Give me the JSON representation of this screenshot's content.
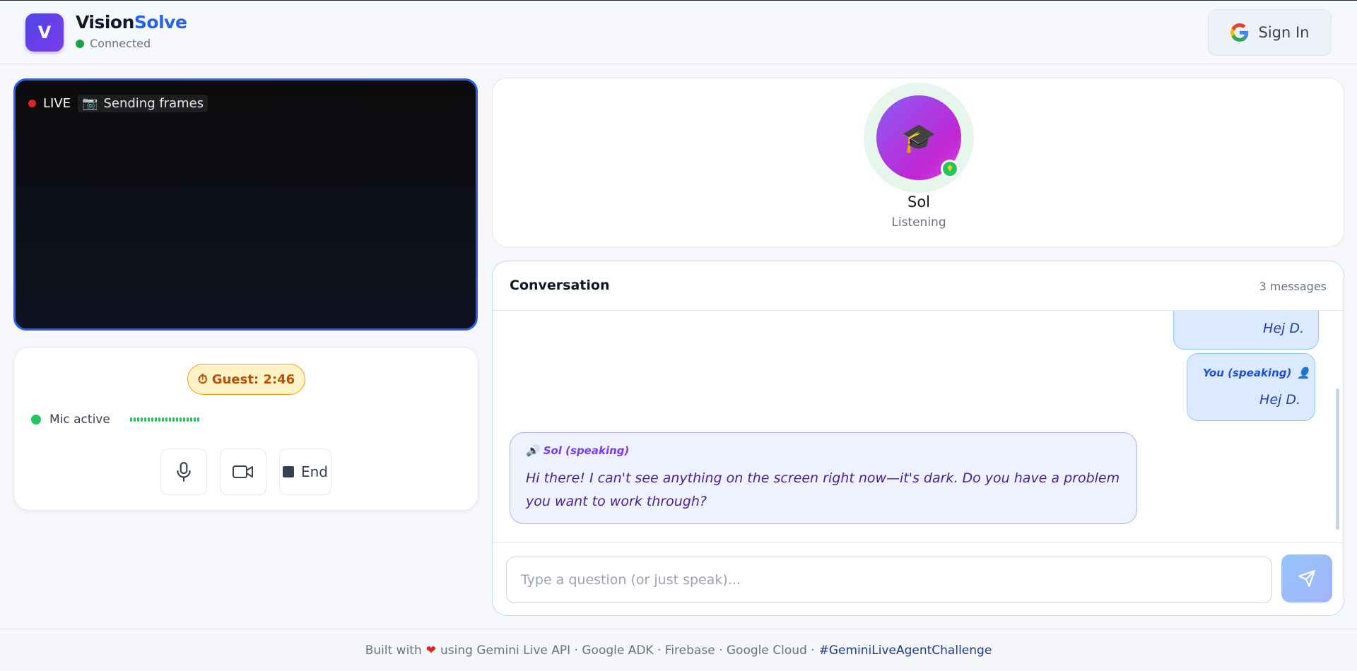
{
  "header": {
    "logo_letter": "V",
    "brand_part1": "Vision",
    "brand_part2": "Solve",
    "connection_status": "Connected",
    "signin_label": "Sign In"
  },
  "video": {
    "live_label": "LIVE",
    "frames_label": "Sending frames",
    "frames_icon": "camera-icon"
  },
  "controls": {
    "timer_icon": "⏱",
    "timer_label": "Guest: 2:46",
    "mic_status": "Mic active",
    "end_label": "End"
  },
  "agent": {
    "avatar_glyph": "🎓",
    "name": "Sol",
    "status": "Listening"
  },
  "conversation": {
    "title": "Conversation",
    "count": "3 messages",
    "messages": [
      {
        "role": "user",
        "speaker": "",
        "text": "Hej D."
      },
      {
        "role": "user",
        "speaker": "You (speaking)",
        "text": "Hej D."
      },
      {
        "role": "assistant",
        "speaker": "Sol (speaking)",
        "text": "Hi there! I can't see anything on the screen right now—it's dark. Do you have a problem you want to work through?"
      }
    ],
    "input_placeholder": "Type a question (or just speak)...",
    "input_value": ""
  },
  "footer": {
    "text_before": "Built with",
    "text_after": "using Gemini Live API · Google ADK · Firebase · Google Cloud ·",
    "hashtag": "#GeminiLiveAgentChallenge"
  },
  "colors": {
    "accent": "#2563eb",
    "brand_gradient_start": "#4f46e5",
    "live_red": "#dc2626",
    "mic_green": "#22c55e",
    "timer_bg": "#fef3c7"
  }
}
